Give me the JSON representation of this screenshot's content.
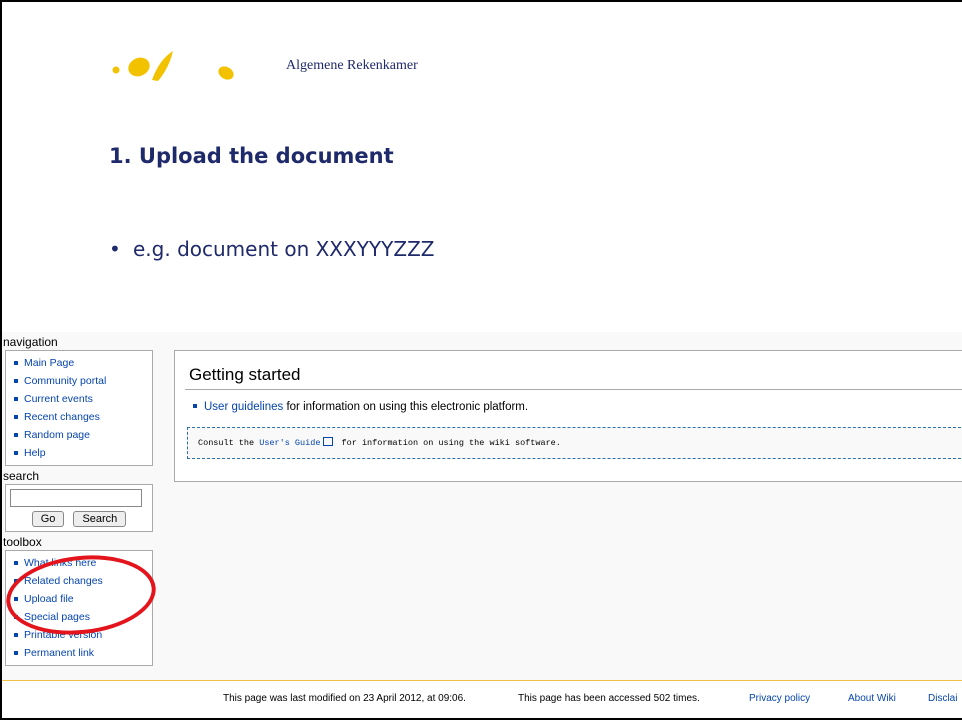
{
  "slide": {
    "org_name": "Algemene Rekenkamer",
    "title": "1. Upload the document",
    "bullet_text": "e.g. document on XXXYYYZZZ"
  },
  "sidebar": {
    "navigation_heading": "navigation",
    "navigation_items": [
      "Main Page",
      "Community portal",
      "Current events",
      "Recent changes",
      "Random page",
      "Help"
    ],
    "search_heading": "search",
    "search_value": "",
    "go_label": "Go",
    "search_label": "Search",
    "toolbox_heading": "toolbox",
    "toolbox_items": [
      "What links here",
      "Related changes",
      "Upload file",
      "Special pages",
      "Printable version",
      "Permanent link"
    ]
  },
  "content": {
    "heading": "Getting started",
    "guideline_link": "User guidelines",
    "guideline_rest": " for information on using this electronic platform.",
    "consult_prefix": "Consult the ",
    "consult_link": "User's Guide",
    "consult_suffix": " for information on using the wiki software."
  },
  "footer": {
    "last_modified": "This page was last modified on 23 April 2012, at 09:06.",
    "accessed": "This page has been accessed 502 times.",
    "privacy": "Privacy policy",
    "about": "About Wiki",
    "disclaimers": "Disclai"
  },
  "colors": {
    "accent": "#1f2a6b",
    "logo_yellow": "#f2c200",
    "link": "#0645ad",
    "highlight_ring": "#e3141c"
  }
}
